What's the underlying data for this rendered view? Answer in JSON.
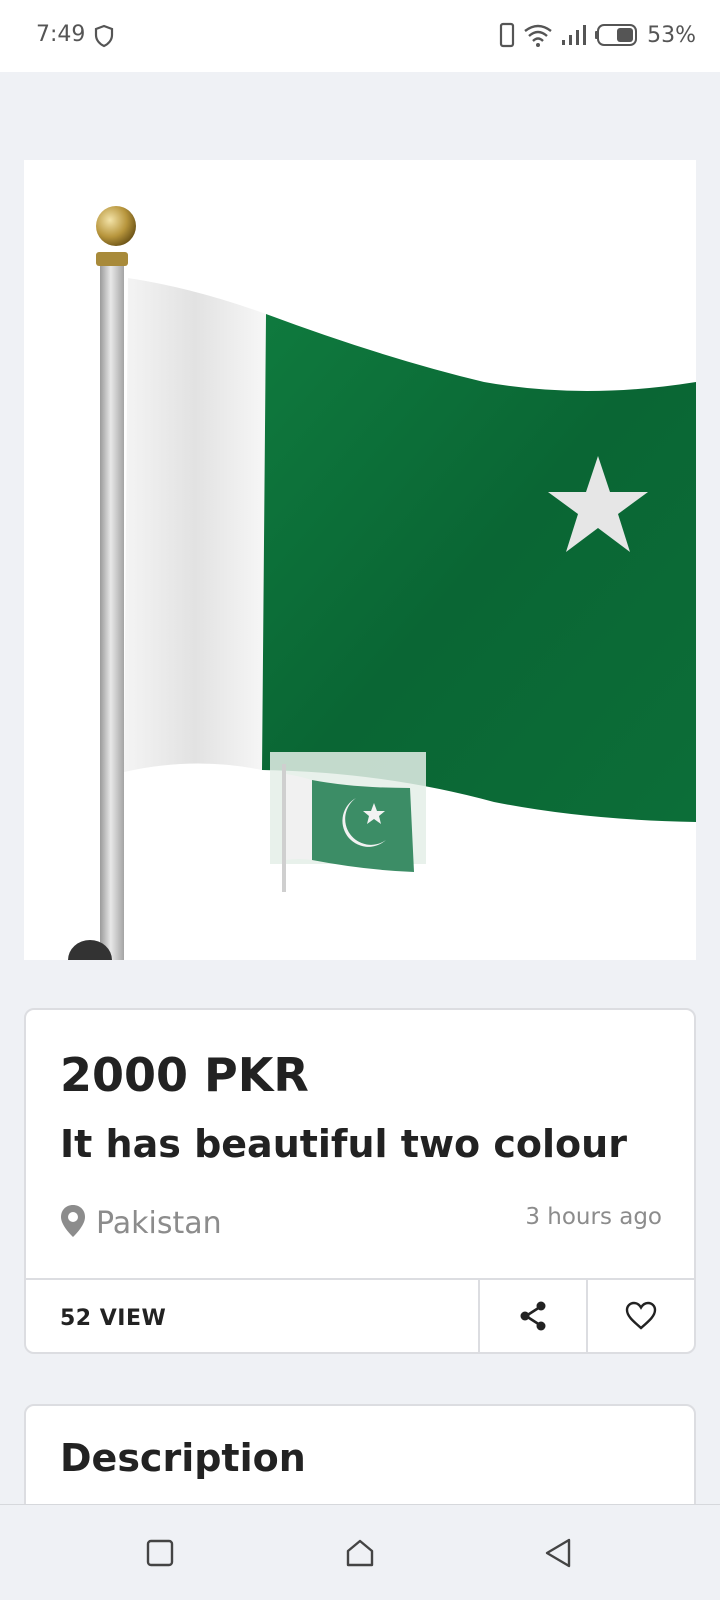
{
  "status_bar": {
    "time": "7:49",
    "battery": "53%",
    "icons": [
      "shield-icon",
      "phone-icon",
      "wifi-icon",
      "signal-icon",
      "battery-icon"
    ]
  },
  "listing": {
    "image_icon": "pakistan-flag-image",
    "price": "2000 PKR",
    "title": "It has beautiful two colour",
    "location": "Pakistan",
    "posted": "3 hours ago",
    "views": "52 VIEW"
  },
  "description": {
    "heading": "Description"
  },
  "colors": {
    "background": "#eff1f5",
    "flag_green": "#0b6b35",
    "text": "#222222",
    "muted": "#8c8c8c"
  }
}
